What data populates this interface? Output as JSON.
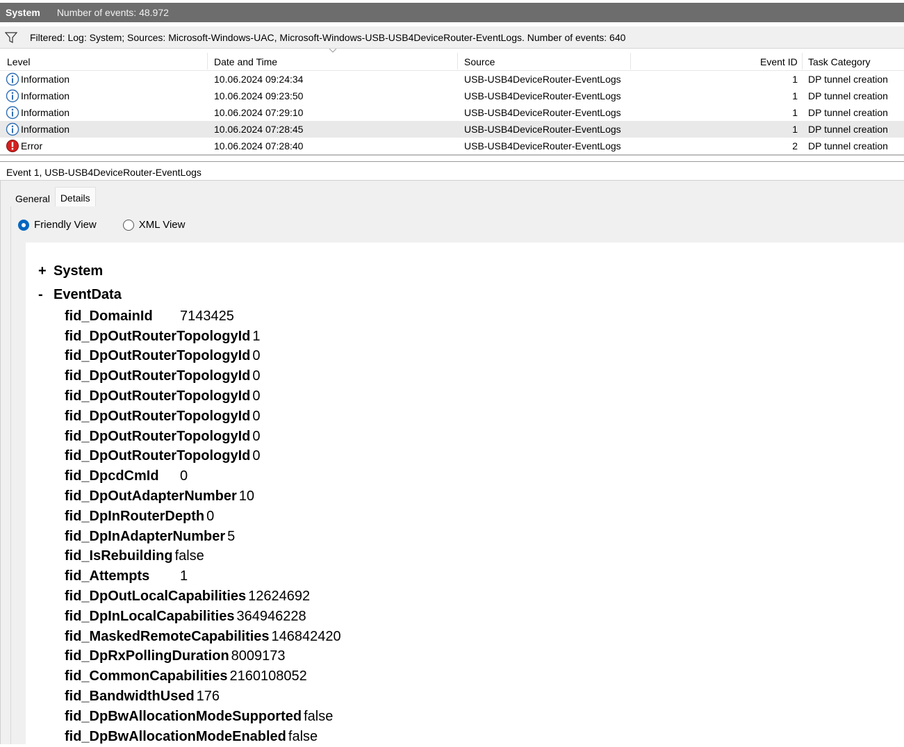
{
  "titlebar": {
    "log_name": "System",
    "event_count_text": "Number of events: 48.972"
  },
  "filter": {
    "text": "Filtered: Log: System; Sources: Microsoft-Windows-UAC, Microsoft-Windows-USB-USB4DeviceRouter-EventLogs. Number of events: 640"
  },
  "columns": {
    "level": "Level",
    "date_time": "Date and Time",
    "source": "Source",
    "event_id": "Event ID",
    "task_category": "Task Category"
  },
  "rows": [
    {
      "level": "Information",
      "icon": "info-icon",
      "date_time": "10.06.2024 09:24:34",
      "source": "USB-USB4DeviceRouter-EventLogs",
      "event_id": "1",
      "task": "DP tunnel creation"
    },
    {
      "level": "Information",
      "icon": "info-icon",
      "date_time": "10.06.2024 09:23:50",
      "source": "USB-USB4DeviceRouter-EventLogs",
      "event_id": "1",
      "task": "DP tunnel creation"
    },
    {
      "level": "Information",
      "icon": "info-icon",
      "date_time": "10.06.2024 07:29:10",
      "source": "USB-USB4DeviceRouter-EventLogs",
      "event_id": "1",
      "task": "DP tunnel creation"
    },
    {
      "level": "Information",
      "icon": "info-icon",
      "date_time": "10.06.2024 07:28:45",
      "source": "USB-USB4DeviceRouter-EventLogs",
      "event_id": "1",
      "task": "DP tunnel creation"
    },
    {
      "level": "Error",
      "icon": "error-icon",
      "date_time": "10.06.2024 07:28:40",
      "source": "USB-USB4DeviceRouter-EventLogs",
      "event_id": "2",
      "task": "DP tunnel creation"
    }
  ],
  "event_title": "Event 1, USB-USB4DeviceRouter-EventLogs",
  "tabs": {
    "general": "General",
    "details": "Details"
  },
  "views": {
    "friendly": "Friendly View",
    "xml": "XML View"
  },
  "tree": {
    "system": {
      "sign": "+",
      "label": "System"
    },
    "eventdata": {
      "sign": "-",
      "label": "EventData"
    },
    "fields": [
      {
        "key": "fid_DomainId",
        "value": "7143425"
      },
      {
        "key": "fid_DpOutRouterTopologyId",
        "value": "1"
      },
      {
        "key": "fid_DpOutRouterTopologyId",
        "value": "0"
      },
      {
        "key": "fid_DpOutRouterTopologyId",
        "value": "0"
      },
      {
        "key": "fid_DpOutRouterTopologyId",
        "value": "0"
      },
      {
        "key": "fid_DpOutRouterTopologyId",
        "value": "0"
      },
      {
        "key": "fid_DpOutRouterTopologyId",
        "value": "0"
      },
      {
        "key": "fid_DpOutRouterTopologyId",
        "value": "0"
      },
      {
        "key": "fid_DpcdCmId",
        "value": "0"
      },
      {
        "key": "fid_DpOutAdapterNumber",
        "value": "10"
      },
      {
        "key": "fid_DpInRouterDepth",
        "value": "0"
      },
      {
        "key": "fid_DpInAdapterNumber",
        "value": "5"
      },
      {
        "key": "fid_IsRebuilding",
        "value": "false"
      },
      {
        "key": "fid_Attempts",
        "value": "1"
      },
      {
        "key": "fid_DpOutLocalCapabilities",
        "value": "12624692"
      },
      {
        "key": "fid_DpInLocalCapabilities",
        "value": "364946228"
      },
      {
        "key": "fid_MaskedRemoteCapabilities",
        "value": "146842420"
      },
      {
        "key": "fid_DpRxPollingDuration",
        "value": "8009173"
      },
      {
        "key": "fid_CommonCapabilities",
        "value": "2160108052"
      },
      {
        "key": "fid_BandwidthUsed",
        "value": "176"
      },
      {
        "key": "fid_DpBwAllocationModeSupported",
        "value": "false"
      },
      {
        "key": "fid_DpBwAllocationModeEnabled",
        "value": "false"
      }
    ]
  },
  "colors": {
    "titlebar": "#6d6d6d",
    "accent": "#0067c0",
    "info": "#2f6fb5",
    "error": "#d32020",
    "selected_row": "#e9e9e9"
  }
}
